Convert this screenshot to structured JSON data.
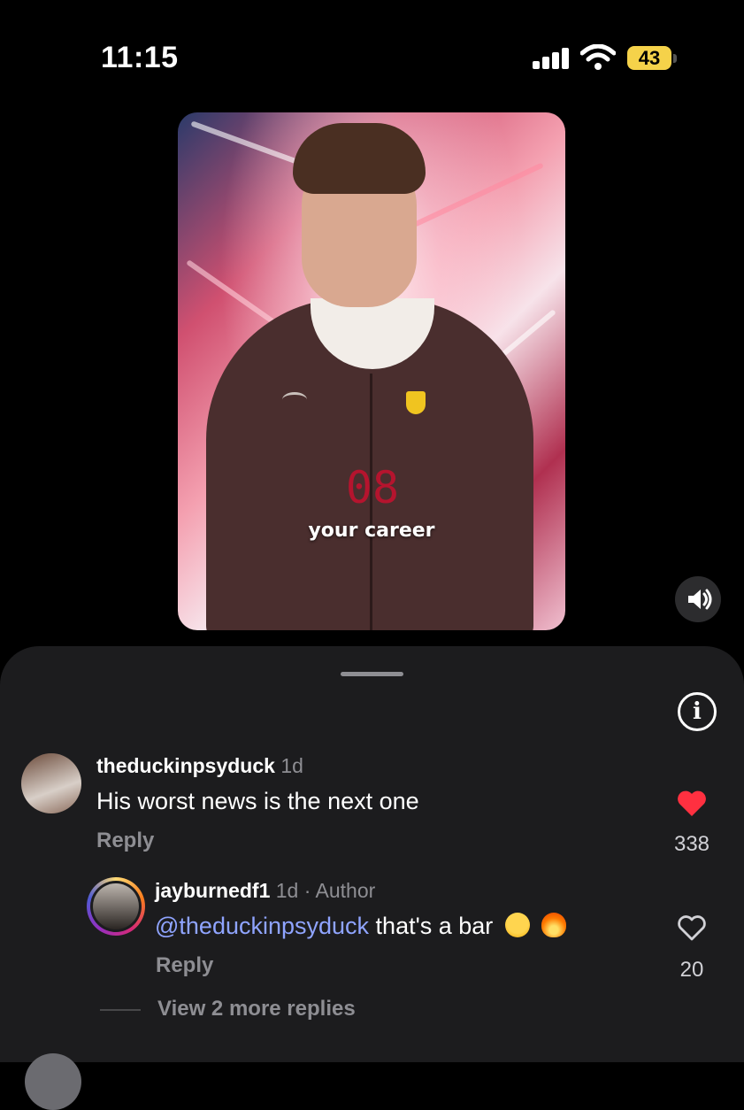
{
  "status_bar": {
    "time": "11:15",
    "battery": "43"
  },
  "video": {
    "caption": "your career",
    "counter": "08"
  },
  "comments": [
    {
      "username": "theduckinpsyduck",
      "age": "1d",
      "text": "His worst news is the next one",
      "reply_label": "Reply",
      "likes": "338",
      "liked": true
    }
  ],
  "reply": {
    "username": "jayburnedf1",
    "age": "1d",
    "author_tag": "· Author",
    "mention": "@theduckinpsyduck",
    "text": " that's a bar",
    "emojis": [
      "loudly-crying-face",
      "fire"
    ],
    "reply_label": "Reply",
    "likes": "20",
    "liked": false
  },
  "view_more": "View 2 more replies",
  "colors": {
    "like_red": "#ff3040",
    "mention_blue": "#8fa4ff",
    "sheet_bg": "#1c1c1e"
  }
}
